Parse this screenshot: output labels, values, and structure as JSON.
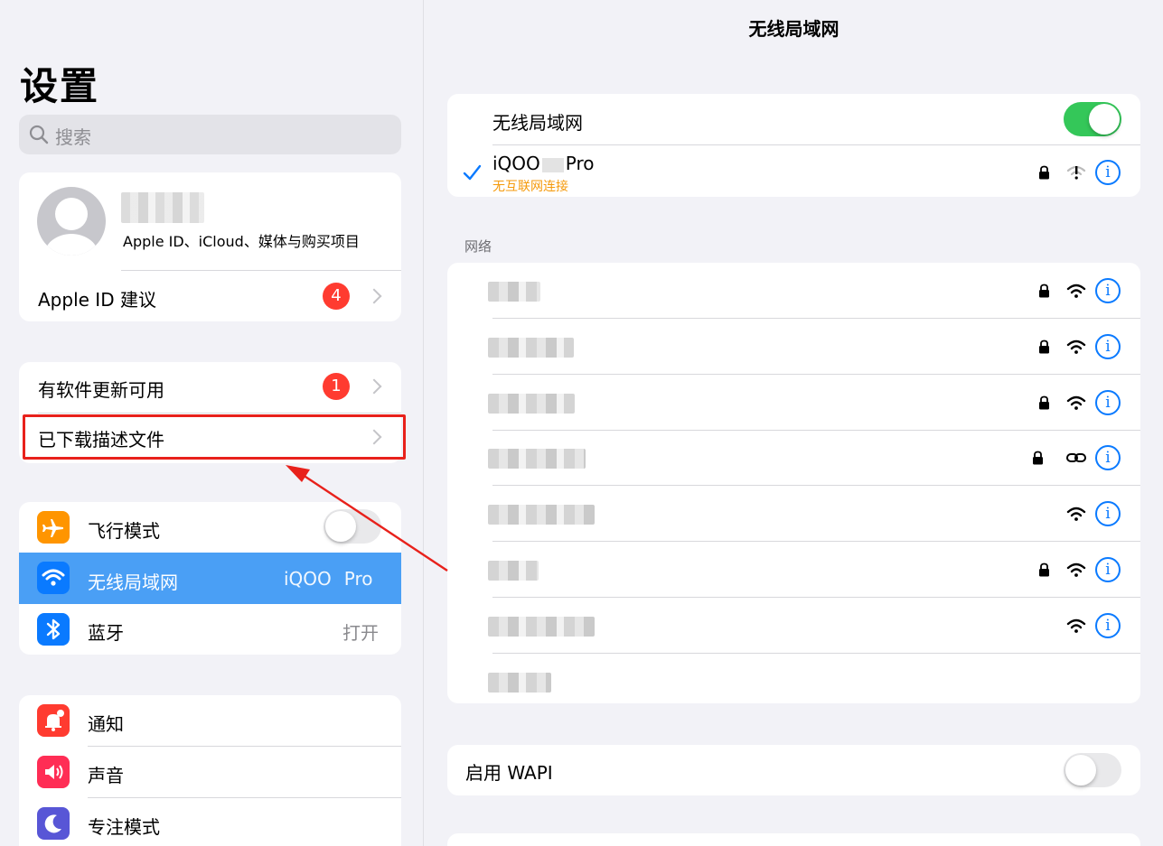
{
  "sidebar": {
    "title": "设置",
    "search_placeholder": "搜索",
    "profile": {
      "subtitle": "Apple ID、iCloud、媒体与购买项目"
    },
    "apple_id_suggestion": {
      "label": "Apple ID 建议",
      "badge": "4"
    },
    "software_update": {
      "label": "有软件更新可用",
      "badge": "1"
    },
    "downloaded_profile": {
      "label": "已下载描述文件"
    },
    "airplane": {
      "label": "飞行模式",
      "on": false
    },
    "wifi": {
      "label": "无线局域网",
      "value": "iQOO",
      "value_suffix": "Pro"
    },
    "bluetooth": {
      "label": "蓝牙",
      "value": "打开"
    },
    "notifications": {
      "label": "通知"
    },
    "sounds": {
      "label": "声音"
    },
    "focus": {
      "label": "专注模式"
    }
  },
  "main": {
    "title": "无线局域网",
    "wifi_toggle": {
      "label": "无线局域网",
      "on": true
    },
    "connected": {
      "name": "iQOO",
      "name_suffix": "Pro",
      "status": "无互联网连接"
    },
    "networks_header": "网络",
    "networks": [
      {
        "lock": true,
        "signal": "full",
        "icon": "wifi-icon"
      },
      {
        "lock": true,
        "signal": "full",
        "icon": "wifi-icon"
      },
      {
        "lock": true,
        "signal": "full",
        "icon": "wifi-icon"
      },
      {
        "lock": true,
        "signal": "link",
        "icon": "link-icon"
      },
      {
        "lock": false,
        "signal": "full",
        "icon": "wifi-icon"
      },
      {
        "lock": true,
        "signal": "full",
        "icon": "wifi-icon"
      },
      {
        "lock": false,
        "signal": "full",
        "icon": "wifi-icon"
      },
      {
        "lock": false,
        "signal": "none",
        "icon": ""
      }
    ],
    "wapi": {
      "label": "启用 WAPI",
      "on": false
    }
  },
  "colors": {
    "accent": "#0a7aff",
    "toggle_on": "#34c759",
    "badge": "#ff3b30",
    "highlight": "#e8211b",
    "selected_row": "#4a9ff5",
    "warning": "#f59a0c"
  }
}
